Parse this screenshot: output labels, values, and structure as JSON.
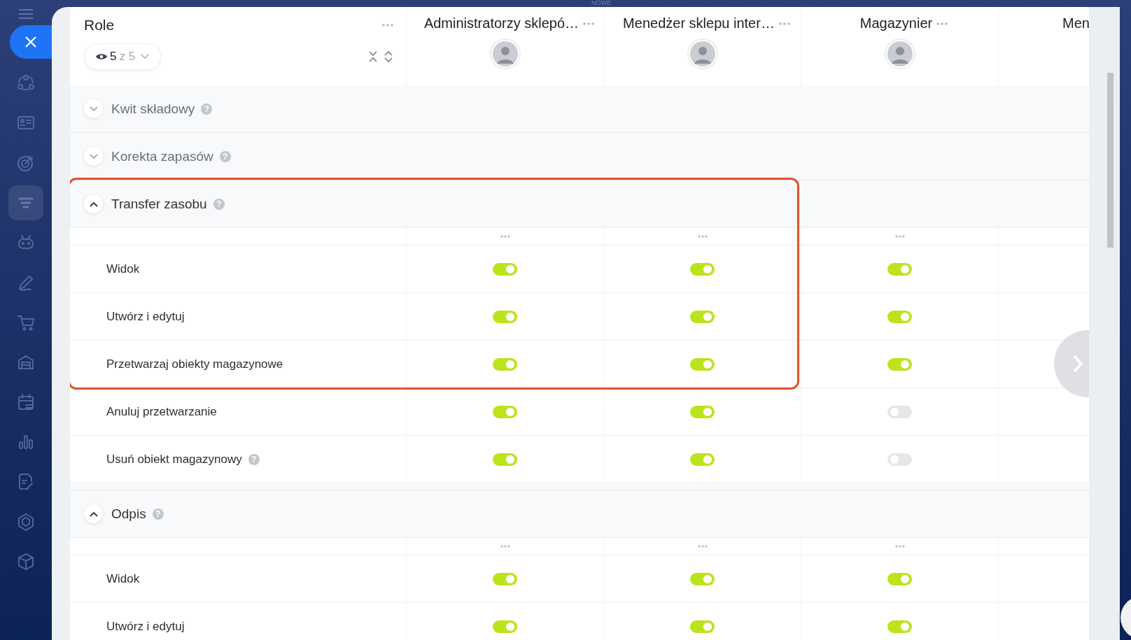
{
  "top_bar": {
    "label": "NOWE"
  },
  "sidebar": {
    "items": [
      {
        "selected": false
      },
      {
        "selected": false
      },
      {
        "selected": false
      },
      {
        "selected": true
      },
      {
        "selected": false
      },
      {
        "selected": false
      },
      {
        "selected": false
      },
      {
        "selected": false
      },
      {
        "selected": false
      },
      {
        "selected": false
      },
      {
        "selected": false
      },
      {
        "selected": false
      },
      {
        "selected": false
      }
    ]
  },
  "header": {
    "title": "Role",
    "filter": {
      "count": "5",
      "total": "z 5"
    }
  },
  "roles": [
    {
      "name": "Administratorzy sklepó…"
    },
    {
      "name": "Menedżer sklepu inter…"
    },
    {
      "name": "Magazynier"
    },
    {
      "name": "Men"
    }
  ],
  "sections": [
    {
      "title": "Kwit składowy",
      "help": "?",
      "expanded": false
    },
    {
      "title": "Korekta zapasów",
      "help": "?",
      "expanded": false
    },
    {
      "title": "Transfer zasobu",
      "help": "?",
      "expanded": true,
      "highlighted": true,
      "rows": [
        {
          "label": "Widok",
          "highlighted": true,
          "permissions": [
            {
              "on": true
            },
            {
              "on": true
            },
            {
              "on": true
            }
          ]
        },
        {
          "label": "Utwórz i edytuj",
          "highlighted": true,
          "permissions": [
            {
              "on": true
            },
            {
              "on": true
            },
            {
              "on": true
            }
          ]
        },
        {
          "label": "Przetwarzaj obiekty magazynowe",
          "highlighted": true,
          "permissions": [
            {
              "on": true
            },
            {
              "on": true
            },
            {
              "on": true
            }
          ]
        },
        {
          "label": "Anuluj przetwarzanie",
          "highlighted": false,
          "permissions": [
            {
              "on": true
            },
            {
              "on": true
            },
            {
              "on": false
            }
          ]
        },
        {
          "label": "Usuń obiekt magazynowy",
          "help": "?",
          "highlighted": false,
          "permissions": [
            {
              "on": true
            },
            {
              "on": true
            },
            {
              "on": false
            }
          ]
        }
      ]
    },
    {
      "title": "Odpis",
      "help": "?",
      "expanded": true,
      "highlighted": false,
      "rows": [
        {
          "label": "Widok",
          "highlighted": false,
          "permissions": [
            {
              "on": true
            },
            {
              "on": true
            },
            {
              "on": true
            }
          ]
        },
        {
          "label": "Utwórz i edytuj",
          "highlighted": false,
          "permissions": [
            {
              "on": true
            },
            {
              "on": true
            },
            {
              "on": true
            }
          ]
        }
      ]
    }
  ]
}
